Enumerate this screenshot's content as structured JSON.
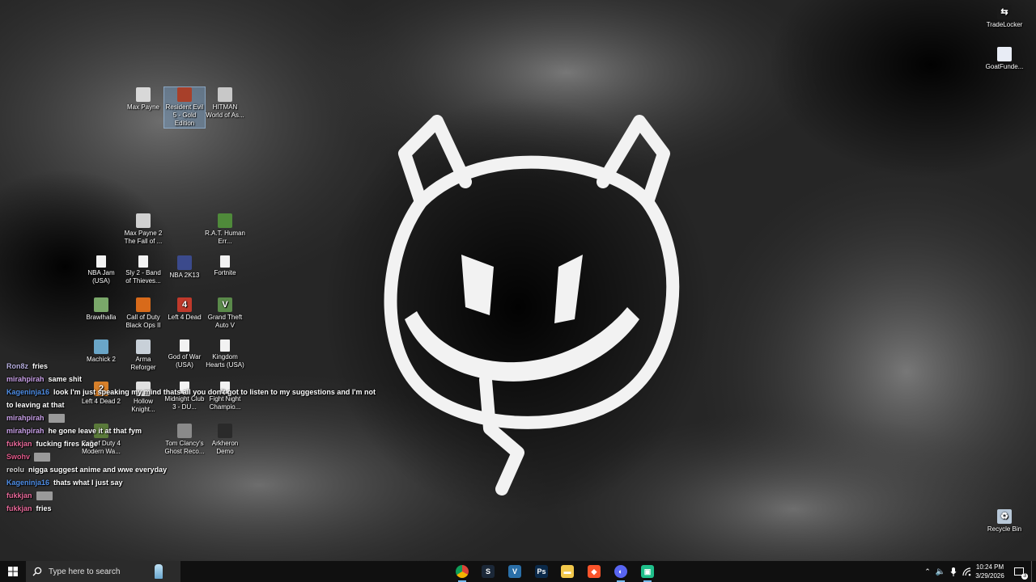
{
  "desktop": {
    "icons": [
      {
        "label": "Max Payne",
        "icon": "max-payne-icon"
      },
      {
        "label": "Resident Evil 5 - Gold Edition",
        "icon": "resident-evil-icon",
        "selected": true
      },
      {
        "label": "HITMAN World of As...",
        "icon": "hitman-icon"
      },
      {
        "label": "Max Payne 2 The Fall of ...",
        "icon": "max-payne-2-icon"
      },
      {
        "label": "R.A.T. Human Err...",
        "icon": "rat-icon"
      },
      {
        "label": "NBA Jam (USA)",
        "icon": "file-icon"
      },
      {
        "label": "Sly 2 - Band of Thieves...",
        "icon": "file-icon"
      },
      {
        "label": "NBA 2K13",
        "icon": "nba-2k13-icon"
      },
      {
        "label": "Fortnite",
        "icon": "file-icon"
      },
      {
        "label": "Brawlhalla",
        "icon": "brawlhalla-icon"
      },
      {
        "label": "Call of Duty Black Ops II",
        "icon": "cod-bo2-icon"
      },
      {
        "label": "Left 4 Dead",
        "icon": "left-4-dead-icon"
      },
      {
        "label": "Grand Theft Auto V",
        "icon": "gta-v-icon"
      },
      {
        "label": "Machick 2",
        "icon": "machick-icon"
      },
      {
        "label": "Arma Reforger",
        "icon": "arma-icon"
      },
      {
        "label": "God of War (USA)",
        "icon": "file-icon"
      },
      {
        "label": "Kingdom Hearts (USA)",
        "icon": "file-icon"
      },
      {
        "label": "Left 4 Dead 2",
        "icon": "left-4-dead-2-icon"
      },
      {
        "label": "Hollow Knight...",
        "icon": "hollow-knight-icon"
      },
      {
        "label": "Midnight Club 3 - DU...",
        "icon": "file-icon"
      },
      {
        "label": "Fight Night Champio...",
        "icon": "file-icon"
      },
      {
        "label": "Call of Duty 4 Modern Wa...",
        "icon": "cod-4-icon"
      },
      {
        "label": "Tom Clancy's Ghost Reco...",
        "icon": "ghost-recon-icon"
      },
      {
        "label": "Arkheron Demo",
        "icon": "arkheron-icon"
      }
    ],
    "right_icons": [
      {
        "label": "TradeLocker",
        "icon": "tradelocker-icon"
      },
      {
        "label": "GoatFunde...",
        "icon": "goatfunded-icon"
      },
      {
        "label": "Recycle Bin",
        "icon": "recycle-bin-icon"
      }
    ]
  },
  "chat": {
    "messages": [
      {
        "user": "Ron8z",
        "color": "#b8b0e0",
        "text": "fries",
        "emote": false
      },
      {
        "user": "mirahpirah",
        "color": "#c9a0e8",
        "text": "same shit",
        "emote": false
      },
      {
        "user": "Kageninja16",
        "color": "#4f8fe8",
        "text": "look I'm just speaking my mind thats all you don't got to listen to my suggestions and I'm not",
        "emote": false
      },
      {
        "user": "",
        "color": "#ffffff",
        "text": "to leaving at that",
        "emote": false
      },
      {
        "user": "mirahpirah",
        "color": "#c9a0e8",
        "text": "",
        "emote": true
      },
      {
        "user": "mirahpirah",
        "color": "#c9a0e8",
        "text": "he gone leave it at that fym",
        "emote": false
      },
      {
        "user": "fukkjan",
        "color": "#e86a9a",
        "text": "fucking fires kage",
        "emote": false
      },
      {
        "user": "Swohv",
        "color": "#e05a8a",
        "text": "",
        "emote": true
      },
      {
        "user": "reolu",
        "color": "#d0d0d0",
        "text": "nigga suggest anime and wwe everyday",
        "emote": false
      },
      {
        "user": "Kageninja16",
        "color": "#4f8fe8",
        "text": "thats what I just say",
        "emote": false
      },
      {
        "user": "fukkjan",
        "color": "#e86a9a",
        "text": "",
        "emote": true
      },
      {
        "user": "fukkjan",
        "color": "#e86a9a",
        "text": "fries",
        "emote": false
      }
    ]
  },
  "taskbar": {
    "search_placeholder": "Type here to search",
    "apps": [
      {
        "name": "chrome-icon",
        "color": "#e8453c",
        "glyph": "◉",
        "running": true
      },
      {
        "name": "steam-icon",
        "color": "#1b2838",
        "glyph": "S",
        "running": false
      },
      {
        "name": "vegas-icon",
        "color": "#2a6fa8",
        "glyph": "V",
        "running": false
      },
      {
        "name": "photoshop-icon",
        "color": "#0b2a4a",
        "glyph": "Ps",
        "running": false
      },
      {
        "name": "file-explorer-icon",
        "color": "#f2c84b",
        "glyph": "▬",
        "running": false
      },
      {
        "name": "brave-icon",
        "color": "#fb542b",
        "glyph": "◆",
        "running": false
      },
      {
        "name": "discord-icon",
        "color": "#5865f2",
        "glyph": "◐",
        "running": true
      },
      {
        "name": "app-icon",
        "color": "#1fbf8a",
        "glyph": "▣",
        "running": true
      }
    ],
    "time": "10:24 PM",
    "date": "3/29/2026",
    "notification_count": "3"
  }
}
